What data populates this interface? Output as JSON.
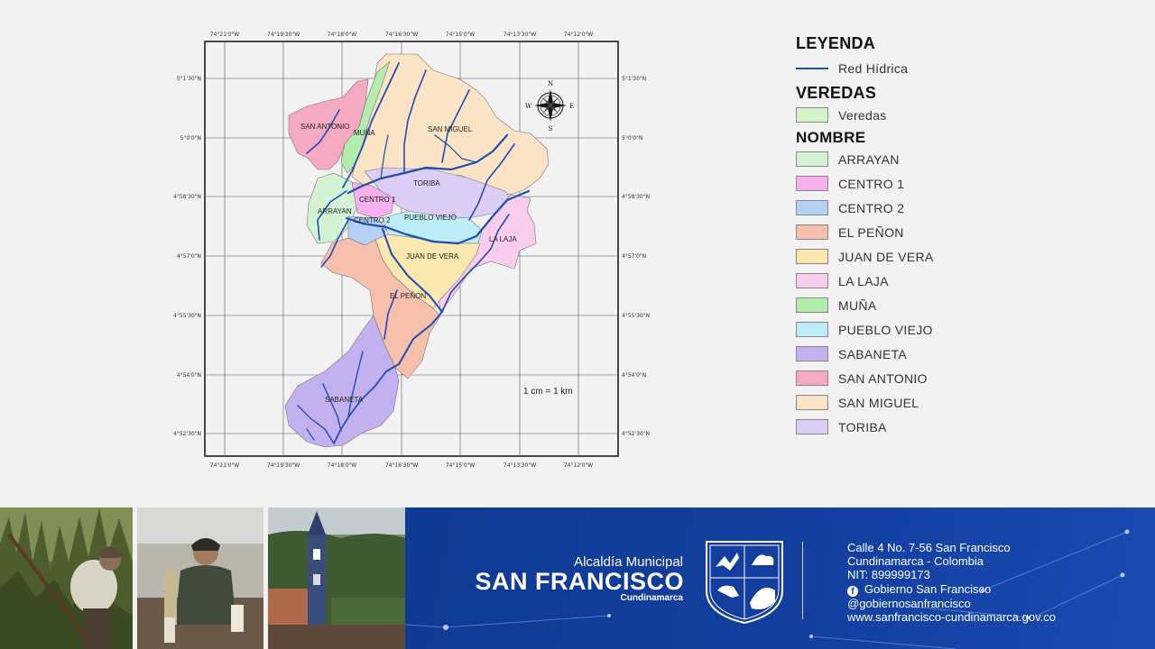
{
  "map": {
    "top_lon_labels": [
      "74°21'0\"W",
      "74°19'30\"W",
      "74°18'0\"W",
      "74°16'30\"W",
      "74°15'0\"W",
      "74°13'30\"W",
      "74°12'0\"W"
    ],
    "bottom_lon_labels": [
      "74°21'0\"W",
      "74°19'30\"W",
      "74°18'0\"W",
      "74°16'30\"W",
      "74°15'0\"W",
      "74°13'30\"W",
      "74°12'0\"W"
    ],
    "left_lat_labels": [
      "5°1'30\"N",
      "5°0'0\"N",
      "4°58'30\"N",
      "4°57'0\"N",
      "4°55'30\"N",
      "4°54'0\"N",
      "4°52'30\"N"
    ],
    "right_lat_labels": [
      "5°1'30\"N",
      "5°0'0\"N",
      "4°58'30\"N",
      "4°57'0\"N",
      "4°55'30\"N",
      "4°54'0\"N",
      "4°52'30\"N"
    ],
    "scale_text": "1 cm = 1 km",
    "compass": {
      "n": "N",
      "s": "S",
      "e": "E",
      "w": "W"
    },
    "region_labels": {
      "san_antonio": "SAN ANTONIO",
      "muna": "MUÑA",
      "san_miguel": "SAN MIGUEL",
      "toriba": "TORIBA",
      "centro1": "CENTRO 1",
      "arrayan": "ARRAYAN",
      "centro2": "CENTRO 2",
      "pueblo_viejo": "PUEBLO VIEJO",
      "la_laja": "LA LAJA",
      "juan_de_vera": "JUAN DE VERA",
      "el_penon": "EL PEÑON",
      "sabaneta": "SABANETA"
    },
    "colors": {
      "arrayan": "#d4f3d4",
      "centro1": "#f6b0ee",
      "centro2": "#b4d2f6",
      "el_penon": "#f7c0ad",
      "juan_de_vera": "#fbe7b0",
      "la_laja": "#f8cdee",
      "muna": "#b4ecab",
      "pueblo_viejo": "#bdedf6",
      "sabaneta": "#c3b0ee",
      "san_antonio": "#f6aac2",
      "san_miguel": "#fbe3c6",
      "toriba": "#dccef6",
      "river": "#1f4db0"
    }
  },
  "legend": {
    "title": "LEYENDA",
    "red_hidrica": "Red Hídrica",
    "veredas_title": "VEREDAS",
    "veredas_label": "Veredas",
    "veredas_color": "#d4f3c8",
    "nombre_title": "NOMBRE",
    "items": [
      {
        "label": "ARRAYAN",
        "color": "#d4f3d4"
      },
      {
        "label": "CENTRO 1",
        "color": "#f6b0ee"
      },
      {
        "label": "CENTRO 2",
        "color": "#b4d2f6"
      },
      {
        "label": "EL PEÑON",
        "color": "#f7c0ad"
      },
      {
        "label": "JUAN DE VERA",
        "color": "#fbe7b0"
      },
      {
        "label": "LA LAJA",
        "color": "#f8cdee"
      },
      {
        "label": "MUÑA",
        "color": "#b4ecab"
      },
      {
        "label": "PUEBLO VIEJO",
        "color": "#bdedf6"
      },
      {
        "label": "SABANETA",
        "color": "#c3b0ee"
      },
      {
        "label": "SAN ANTONIO",
        "color": "#f6aac2"
      },
      {
        "label": "SAN MIGUEL",
        "color": "#fbe3c6"
      },
      {
        "label": "TORIBA",
        "color": "#dccef6"
      }
    ]
  },
  "footer": {
    "alcaldia": "Alcaldía Municipal",
    "municipio": "SAN FRANCISCO",
    "departamento": "Cundinamarca",
    "contact": {
      "address": "Calle 4 No. 7-56 San Francisco",
      "location": "Cundinamarca - Colombia",
      "nit": "NIT: 899999173",
      "facebook": "Gobierno San Francisco",
      "handle": "@gobiernosanfrancisco",
      "website": "www.sanfrancisco-cundinamarca.gov.co"
    }
  }
}
